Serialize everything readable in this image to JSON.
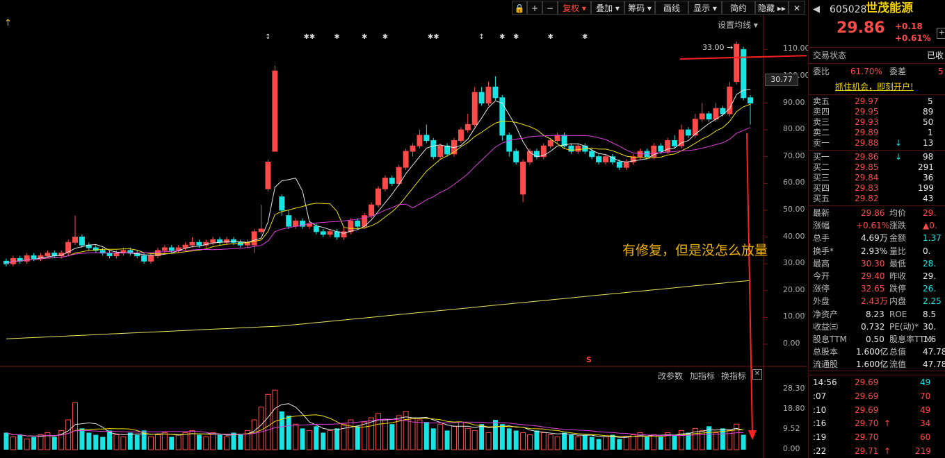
{
  "toolbar": {
    "items": [
      "复权",
      "叠加",
      "筹码",
      "画线",
      "显示",
      "简约",
      "隐藏"
    ],
    "arrow_up": "↑",
    "ma_setting": "设置均线"
  },
  "chart": {
    "y_ticks_main": [
      "110.00",
      "100.00",
      "90.00",
      "80.00",
      "70.00",
      "60.00",
      "50.00",
      "40.00",
      "30.00",
      "20.00",
      "10.00",
      "0.00"
    ],
    "current_price_tag": "30.77",
    "peak_label": "33.00",
    "y_ticks_vol": [
      "28.30",
      "18.80",
      "9.52",
      "0.00"
    ],
    "vol_toolbar": [
      "改参数",
      "加指标",
      "换指标"
    ],
    "close_x": "✕",
    "s_marker": "S",
    "annotation": "有修复，但是没怎么放量",
    "event_marks": [
      "↕",
      "✱✱",
      "✱",
      "✱",
      "✱",
      "✱✱",
      "↕",
      "✱",
      "✱",
      "✱",
      "✱"
    ]
  },
  "chart_data": {
    "type": "candlestick",
    "candles": [
      {
        "o": 31,
        "c": 30,
        "h": 32,
        "l": 29
      },
      {
        "o": 30,
        "c": 32,
        "h": 33,
        "l": 29
      },
      {
        "o": 32,
        "c": 31,
        "h": 33,
        "l": 30
      },
      {
        "o": 31,
        "c": 33,
        "h": 34,
        "l": 30
      },
      {
        "o": 33,
        "c": 32,
        "h": 34,
        "l": 31
      },
      {
        "o": 32,
        "c": 33,
        "h": 34,
        "l": 31
      },
      {
        "o": 33,
        "c": 34,
        "h": 35,
        "l": 32
      },
      {
        "o": 34,
        "c": 33,
        "h": 35,
        "l": 32
      },
      {
        "o": 33,
        "c": 34,
        "h": 35,
        "l": 32
      },
      {
        "o": 34,
        "c": 38,
        "h": 39,
        "l": 33
      },
      {
        "o": 38,
        "c": 40,
        "h": 48,
        "l": 37
      },
      {
        "o": 40,
        "c": 37,
        "h": 41,
        "l": 36
      },
      {
        "o": 37,
        "c": 36,
        "h": 38,
        "l": 35
      },
      {
        "o": 36,
        "c": 35,
        "h": 37,
        "l": 34
      },
      {
        "o": 35,
        "c": 34,
        "h": 36,
        "l": 33
      },
      {
        "o": 34,
        "c": 33,
        "h": 35,
        "l": 32
      },
      {
        "o": 33,
        "c": 34,
        "h": 35,
        "l": 32
      },
      {
        "o": 34,
        "c": 35,
        "h": 36,
        "l": 33
      },
      {
        "o": 35,
        "c": 34,
        "h": 36,
        "l": 33
      },
      {
        "o": 34,
        "c": 33,
        "h": 35,
        "l": 32
      },
      {
        "o": 33,
        "c": 31,
        "h": 34,
        "l": 30
      },
      {
        "o": 31,
        "c": 33,
        "h": 34,
        "l": 30
      },
      {
        "o": 33,
        "c": 35,
        "h": 36,
        "l": 32
      },
      {
        "o": 35,
        "c": 36,
        "h": 37,
        "l": 34
      },
      {
        "o": 36,
        "c": 35,
        "h": 37,
        "l": 34
      },
      {
        "o": 35,
        "c": 36,
        "h": 37,
        "l": 34
      },
      {
        "o": 36,
        "c": 37,
        "h": 38,
        "l": 35
      },
      {
        "o": 37,
        "c": 38,
        "h": 40,
        "l": 36
      },
      {
        "o": 38,
        "c": 37,
        "h": 39,
        "l": 36
      },
      {
        "o": 37,
        "c": 38,
        "h": 39,
        "l": 36
      },
      {
        "o": 38,
        "c": 39,
        "h": 40,
        "l": 37
      },
      {
        "o": 39,
        "c": 38,
        "h": 40,
        "l": 37
      },
      {
        "o": 38,
        "c": 39,
        "h": 40,
        "l": 37
      },
      {
        "o": 39,
        "c": 38,
        "h": 40,
        "l": 37
      },
      {
        "o": 38,
        "c": 37,
        "h": 39,
        "l": 36
      },
      {
        "o": 37,
        "c": 38,
        "h": 39,
        "l": 36
      },
      {
        "o": 37,
        "c": 42,
        "h": 43,
        "l": 34
      },
      {
        "o": 42,
        "c": 43,
        "h": 52,
        "l": 41
      },
      {
        "o": 58,
        "c": 68,
        "h": 69,
        "l": 57
      },
      {
        "o": 72,
        "c": 102,
        "h": 104,
        "l": 72
      },
      {
        "o": 55,
        "c": 50,
        "h": 56,
        "l": 48
      },
      {
        "o": 48,
        "c": 44,
        "h": 50,
        "l": 43
      },
      {
        "o": 44,
        "c": 46,
        "h": 47,
        "l": 43
      },
      {
        "o": 46,
        "c": 44,
        "h": 47,
        "l": 43
      },
      {
        "o": 44,
        "c": 45,
        "h": 46,
        "l": 43
      },
      {
        "o": 44,
        "c": 42,
        "h": 45,
        "l": 41
      },
      {
        "o": 42,
        "c": 41,
        "h": 43,
        "l": 40
      },
      {
        "o": 41,
        "c": 42,
        "h": 43,
        "l": 40
      },
      {
        "o": 42,
        "c": 40,
        "h": 43,
        "l": 39
      },
      {
        "o": 40,
        "c": 42,
        "h": 44,
        "l": 39
      },
      {
        "o": 42,
        "c": 46,
        "h": 47,
        "l": 41
      },
      {
        "o": 46,
        "c": 44,
        "h": 47,
        "l": 43
      },
      {
        "o": 44,
        "c": 48,
        "h": 49,
        "l": 43
      },
      {
        "o": 48,
        "c": 52,
        "h": 53,
        "l": 47
      },
      {
        "o": 52,
        "c": 58,
        "h": 59,
        "l": 51
      },
      {
        "o": 58,
        "c": 62,
        "h": 63,
        "l": 57
      },
      {
        "o": 62,
        "c": 60,
        "h": 63,
        "l": 59
      },
      {
        "o": 60,
        "c": 66,
        "h": 67,
        "l": 59
      },
      {
        "o": 66,
        "c": 72,
        "h": 73,
        "l": 65
      },
      {
        "o": 72,
        "c": 74,
        "h": 75,
        "l": 70
      },
      {
        "o": 74,
        "c": 78,
        "h": 80,
        "l": 73
      },
      {
        "o": 78,
        "c": 76,
        "h": 82,
        "l": 75
      },
      {
        "o": 76,
        "c": 70,
        "h": 77,
        "l": 69
      },
      {
        "o": 70,
        "c": 74,
        "h": 75,
        "l": 69
      },
      {
        "o": 74,
        "c": 71,
        "h": 75,
        "l": 70
      },
      {
        "o": 71,
        "c": 76,
        "h": 77,
        "l": 70
      },
      {
        "o": 76,
        "c": 80,
        "h": 81,
        "l": 75
      },
      {
        "o": 80,
        "c": 82,
        "h": 86,
        "l": 79
      },
      {
        "o": 82,
        "c": 94,
        "h": 96,
        "l": 81
      },
      {
        "o": 94,
        "c": 90,
        "h": 96,
        "l": 89
      },
      {
        "o": 90,
        "c": 96,
        "h": 98,
        "l": 89
      },
      {
        "o": 96,
        "c": 92,
        "h": 100,
        "l": 91
      },
      {
        "o": 92,
        "c": 78,
        "h": 93,
        "l": 76
      },
      {
        "o": 78,
        "c": 72,
        "h": 79,
        "l": 70
      },
      {
        "o": 72,
        "c": 68,
        "h": 73,
        "l": 67
      },
      {
        "o": 56,
        "c": 68,
        "h": 69,
        "l": 53
      },
      {
        "o": 68,
        "c": 72,
        "h": 73,
        "l": 67
      },
      {
        "o": 72,
        "c": 70,
        "h": 73,
        "l": 69
      },
      {
        "o": 70,
        "c": 74,
        "h": 75,
        "l": 69
      },
      {
        "o": 74,
        "c": 76,
        "h": 77,
        "l": 73
      },
      {
        "o": 76,
        "c": 78,
        "h": 79,
        "l": 75
      },
      {
        "o": 78,
        "c": 74,
        "h": 79,
        "l": 73
      },
      {
        "o": 74,
        "c": 72,
        "h": 75,
        "l": 71
      },
      {
        "o": 72,
        "c": 74,
        "h": 75,
        "l": 71
      },
      {
        "o": 74,
        "c": 72,
        "h": 75,
        "l": 71
      },
      {
        "o": 72,
        "c": 70,
        "h": 73,
        "l": 69
      },
      {
        "o": 70,
        "c": 68,
        "h": 71,
        "l": 67
      },
      {
        "o": 68,
        "c": 70,
        "h": 71,
        "l": 67
      },
      {
        "o": 70,
        "c": 68,
        "h": 71,
        "l": 67
      },
      {
        "o": 68,
        "c": 66,
        "h": 69,
        "l": 65
      },
      {
        "o": 66,
        "c": 68,
        "h": 69,
        "l": 65
      },
      {
        "o": 68,
        "c": 70,
        "h": 71,
        "l": 67
      },
      {
        "o": 70,
        "c": 72,
        "h": 73,
        "l": 69
      },
      {
        "o": 72,
        "c": 70,
        "h": 73,
        "l": 69
      },
      {
        "o": 70,
        "c": 74,
        "h": 75,
        "l": 69
      },
      {
        "o": 74,
        "c": 72,
        "h": 75,
        "l": 71
      },
      {
        "o": 72,
        "c": 76,
        "h": 77,
        "l": 71
      },
      {
        "o": 76,
        "c": 74,
        "h": 78,
        "l": 73
      },
      {
        "o": 74,
        "c": 80,
        "h": 82,
        "l": 73
      },
      {
        "o": 80,
        "c": 78,
        "h": 81,
        "l": 77
      },
      {
        "o": 78,
        "c": 84,
        "h": 86,
        "l": 77
      },
      {
        "o": 84,
        "c": 86,
        "h": 90,
        "l": 83
      },
      {
        "o": 86,
        "c": 84,
        "h": 87,
        "l": 83
      },
      {
        "o": 84,
        "c": 88,
        "h": 90,
        "l": 83
      },
      {
        "o": 88,
        "c": 86,
        "h": 89,
        "l": 85
      },
      {
        "o": 86,
        "c": 96,
        "h": 98,
        "l": 85
      },
      {
        "o": 98,
        "c": 112,
        "h": 113,
        "l": 97
      },
      {
        "o": 110,
        "c": 92,
        "h": 111,
        "l": 91
      },
      {
        "o": 92,
        "c": 90,
        "h": 93,
        "l": 82
      }
    ],
    "volume_bars": [
      8,
      6,
      7,
      5,
      6,
      7,
      8,
      6,
      9,
      14,
      22,
      10,
      8,
      7,
      6,
      9,
      7,
      6,
      8,
      7,
      9,
      6,
      7,
      8,
      6,
      7,
      8,
      9,
      7,
      6,
      8,
      7,
      6,
      8,
      7,
      9,
      14,
      20,
      26,
      28,
      18,
      16,
      12,
      10,
      9,
      11,
      8,
      9,
      10,
      12,
      14,
      11,
      13,
      15,
      17,
      14,
      12,
      16,
      18,
      15,
      14,
      13,
      10,
      12,
      9,
      11,
      13,
      10,
      9,
      12,
      8,
      14,
      12,
      10,
      9,
      8,
      7,
      9,
      8,
      7,
      6,
      8,
      7,
      6,
      7,
      6,
      5,
      6,
      7,
      5,
      6,
      7,
      8,
      6,
      7,
      6,
      8,
      7,
      9,
      8,
      10,
      9,
      11,
      8,
      10,
      9,
      12,
      7
    ],
    "ma_lines": [
      "white",
      "yellow",
      "magenta",
      "light-yellow"
    ]
  },
  "quote": {
    "code": "605028",
    "name": "世茂能源",
    "price": "29.86",
    "change": "+0.18",
    "change_pct": "+0.61%",
    "trade_status_label": "交易状态",
    "trade_status_value": "已收",
    "ratio_label": "委比",
    "ratio_value": "61.70%",
    "diff_label": "委差",
    "diff_value": "5",
    "promo": "抓住机会，即刻开户!",
    "sells": [
      {
        "label": "卖五",
        "price": "29.97",
        "vol": "5"
      },
      {
        "label": "卖四",
        "price": "29.95",
        "vol": "89"
      },
      {
        "label": "卖三",
        "price": "29.93",
        "vol": "50"
      },
      {
        "label": "卖二",
        "price": "29.89",
        "vol": "1"
      },
      {
        "label": "卖一",
        "price": "29.88",
        "vol": "13"
      }
    ],
    "buys": [
      {
        "label": "买一",
        "price": "29.86",
        "vol": "98"
      },
      {
        "label": "买二",
        "price": "29.85",
        "vol": "291"
      },
      {
        "label": "买三",
        "price": "29.84",
        "vol": "36"
      },
      {
        "label": "买四",
        "price": "29.83",
        "vol": "199"
      },
      {
        "label": "买五",
        "price": "29.82",
        "vol": "43"
      }
    ],
    "stats": [
      {
        "l1": "最新",
        "v1": "29.86",
        "c1": "red",
        "l2": "均价",
        "v2": "29.",
        "c2": "red"
      },
      {
        "l1": "涨幅",
        "v1": "+0.61%",
        "c1": "red",
        "l2": "涨跌",
        "v2": "▲0.",
        "c2": "red"
      },
      {
        "l1": "总手",
        "v1": "4.69万",
        "c1": "white",
        "l2": "金额",
        "v2": "1.37",
        "c2": "green"
      },
      {
        "l1": "换手*",
        "v1": "2.93%",
        "c1": "white",
        "l2": "量比",
        "v2": "0.",
        "c2": "white"
      },
      {
        "l1": "最高",
        "v1": "30.30",
        "c1": "red",
        "l2": "最低",
        "v2": "28.",
        "c2": "green"
      },
      {
        "l1": "今开",
        "v1": "29.40",
        "c1": "red",
        "l2": "昨收",
        "v2": "29.",
        "c2": "white"
      },
      {
        "l1": "涨停",
        "v1": "32.65",
        "c1": "red",
        "l2": "跌停",
        "v2": "26.",
        "c2": "green"
      },
      {
        "l1": "外盘",
        "v1": "2.43万",
        "c1": "red",
        "l2": "内盘",
        "v2": "2.25",
        "c2": "green"
      },
      {
        "l1": "净资产",
        "v1": "8.23",
        "c1": "white",
        "l2": "ROE",
        "v2": "8.5",
        "c2": "white"
      },
      {
        "l1": "收益㈢",
        "v1": "0.732",
        "c1": "white",
        "l2": "PE(动)*",
        "v2": "30.",
        "c2": "white"
      },
      {
        "l1": "股息TTM",
        "v1": "0.50",
        "c1": "white",
        "l2": "股息率TTM",
        "v2": "1.6",
        "c2": "white"
      },
      {
        "l1": "总股本",
        "v1": "1.600亿",
        "c1": "white",
        "l2": "总值",
        "v2": "47.78",
        "c2": "white"
      },
      {
        "l1": "流通股",
        "v1": "1.600亿",
        "c1": "white",
        "l2": "流值",
        "v2": "47.78",
        "c2": "white"
      }
    ],
    "ticks": [
      {
        "t": "14:56",
        "p": "29.69",
        "v": "49",
        "vc": "green",
        "arrow": ""
      },
      {
        "t": ":07",
        "p": "29.69",
        "v": "70",
        "vc": "red",
        "arrow": ""
      },
      {
        "t": ":10",
        "p": "29.69",
        "v": "49",
        "vc": "red",
        "arrow": ""
      },
      {
        "t": ":16",
        "p": "29.70",
        "v": "34",
        "vc": "red",
        "arrow": "↑"
      },
      {
        "t": ":19",
        "p": "29.70",
        "v": "60",
        "vc": "red",
        "arrow": ""
      },
      {
        "t": ":22",
        "p": "29.71",
        "v": "219",
        "vc": "red",
        "arrow": "↑"
      }
    ],
    "down_arrow": "↓"
  },
  "colors": {
    "up": "#ff4a4a",
    "down": "#18e4e4",
    "ma5": "#e8e8e8",
    "ma10": "#f0e000",
    "ma20": "#e040e0",
    "ma250": "#e8e860"
  }
}
